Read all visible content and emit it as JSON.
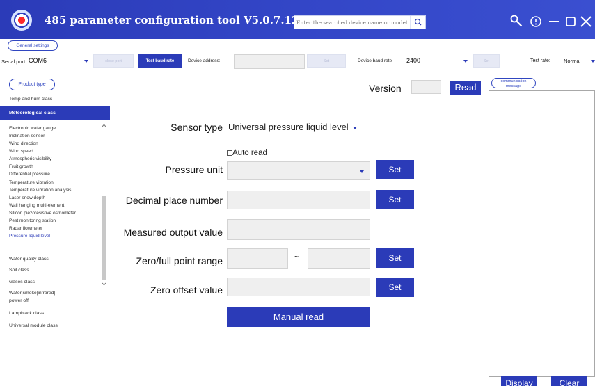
{
  "app": {
    "title": "485 parameter configuration tool V5.0.7.12",
    "search_placeholder": "Enter the searched device name or model"
  },
  "settings": {
    "group_label": "General settings",
    "serial_port_label": "Serial port",
    "serial_port_value": "COM6",
    "close_port_label": "close port",
    "test_baud_rate_label": "Test baud rate",
    "device_address_label": "Device address:",
    "device_address_value": "",
    "set_label": "Set",
    "device_baud_rate_label": "Device baud rate",
    "device_baud_rate_value": "2400",
    "set2_label": "Set",
    "test_rate_label": "Test rate:",
    "test_rate_value": "Normal"
  },
  "sidebar": {
    "group_label": "Product type",
    "top_items": [
      "Temp and hum class"
    ],
    "active_item": "Meteorological class",
    "sub_items": [
      "Electronic water gauge",
      "Inclination sensor",
      "Wind direction",
      "Wind speed",
      "Atmospheric visibility",
      "Fruit growth",
      "Differential pressure",
      "Temperature vibration",
      "Temperature vibration analysis",
      "Laser snow depth",
      "Wall hanging multi-element",
      "Silicon piezoresistive osmometer",
      "Pest monitoring station",
      "Radar flowmeter",
      "Pressure liquid level"
    ],
    "bottom_items": [
      "Water quality class",
      "Soil class",
      "Gases class",
      "Water|smoke|infrared|",
      "power off",
      "Lampblack class",
      "Universal module class"
    ]
  },
  "main": {
    "version_label": "Version",
    "version_value": "",
    "read_label": "Read",
    "sensor_type_label": "Sensor type",
    "sensor_type_value": "Universal pressure liquid level",
    "auto_read_label": "Auto read",
    "pressure_unit_label": "Pressure unit",
    "decimal_place_label": "Decimal place number",
    "measured_output_label": "Measured output value",
    "zero_full_label": "Zero/full point range",
    "range_separator": "~",
    "zero_offset_label": "Zero offset value",
    "set_label": "Set",
    "manual_read_label": "Manual read"
  },
  "comm": {
    "label_line1": "communication",
    "label_line2": "message",
    "display_label": "Display",
    "clear_label": "Clear"
  },
  "colors": {
    "accent": "#2b3bb8",
    "title_bar": "#3346c7",
    "field_bg": "#efefef"
  }
}
